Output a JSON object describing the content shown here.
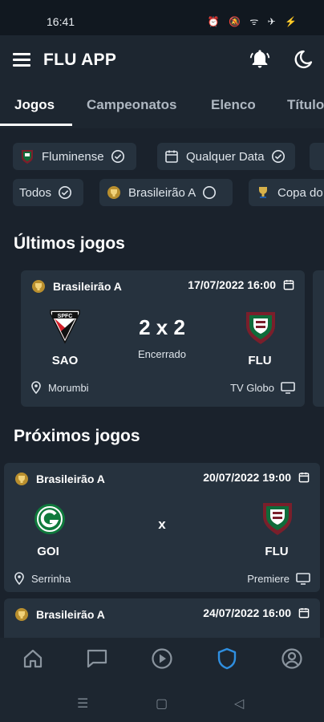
{
  "status_bar": {
    "time": "16:41",
    "icons": [
      "alarm-icon",
      "silent-icon",
      "wifi-icon",
      "airplane-icon",
      "battery-icon"
    ]
  },
  "app": {
    "title": "FLU APP"
  },
  "tabs": [
    {
      "label": "Jogos",
      "active": true
    },
    {
      "label": "Campeonatos",
      "active": false
    },
    {
      "label": "Elenco",
      "active": false
    },
    {
      "label": "Títulos",
      "active": false
    }
  ],
  "filters": {
    "row1": [
      {
        "label": "Fluminense",
        "icon": "fluminense-crest-icon",
        "selected": true
      },
      {
        "label": "Qualquer Data",
        "icon": "calendar-icon",
        "selected": true
      }
    ],
    "row2": [
      {
        "label": "Todos",
        "selected": true
      },
      {
        "label": "Brasileirão A",
        "icon": "brasileirao-trophy-icon",
        "selected": false
      },
      {
        "label": "Copa do Brasil",
        "icon": "copa-trophy-icon",
        "selected": false
      }
    ]
  },
  "last_games": {
    "title": "Últimos jogos",
    "games": [
      {
        "championship": "Brasileirão A",
        "datetime": "17/07/2022 16:00",
        "home": "SAO",
        "away": "FLU",
        "score": "2 x 2",
        "status": "Encerrado",
        "venue": "Morumbi",
        "broadcast": "TV Globo"
      }
    ]
  },
  "next_games": {
    "title": "Próximos jogos",
    "games": [
      {
        "championship": "Brasileirão A",
        "datetime": "20/07/2022 19:00",
        "home": "GOI",
        "away": "FLU",
        "vs": "x",
        "venue": "Serrinha",
        "broadcast": "Premiere"
      },
      {
        "championship": "Brasileirão A",
        "datetime": "24/07/2022 16:00"
      }
    ]
  },
  "bottom_nav": [
    {
      "icon": "home-icon",
      "active": false
    },
    {
      "icon": "chat-icon",
      "active": false
    },
    {
      "icon": "play-icon",
      "active": false
    },
    {
      "icon": "shield-icon",
      "active": true
    },
    {
      "icon": "profile-icon",
      "active": false
    }
  ],
  "colors": {
    "background": "#1a222c",
    "card": "#26323e",
    "accent": "#2f8fe0",
    "text": "#ffffff",
    "muted": "#aeb7c1"
  }
}
